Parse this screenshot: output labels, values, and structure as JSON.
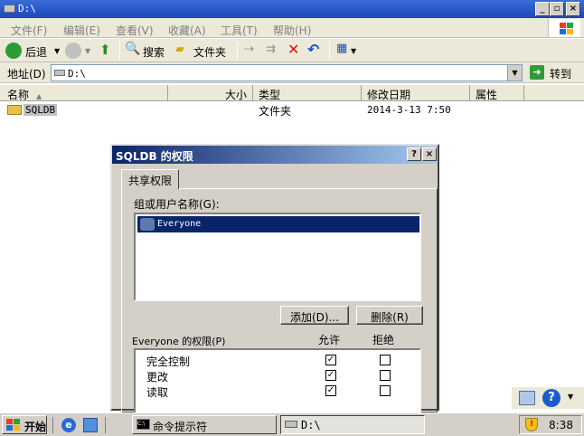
{
  "window": {
    "title": "D:\\"
  },
  "menu": [
    "文件(F)",
    "编辑(E)",
    "查看(V)",
    "收藏(A)",
    "工具(T)",
    "帮助(H)"
  ],
  "toolbar": {
    "back_label": "后退",
    "search_label": "搜索",
    "folders_label": "文件夹"
  },
  "address": {
    "label": "地址(D)",
    "value": "D:\\",
    "go_label": "转到"
  },
  "columns": [
    "名称",
    "大小",
    "类型",
    "修改日期",
    "属性"
  ],
  "files": [
    {
      "name": "SQLDB",
      "size": "",
      "type": "文件夹",
      "modified": "2014-3-13 7:50",
      "attr": ""
    }
  ],
  "dialog": {
    "title": "SQLDB 的权限",
    "help_label": "?",
    "close_label": "×",
    "tab_label": "共享权限",
    "group_label": "组或用户名称(G):",
    "users": [
      "Everyone"
    ],
    "add_label": "添加(D)...",
    "remove_label": "删除(R)",
    "perm_header": "Everyone 的权限(P)",
    "allow_label": "允许",
    "deny_label": "拒绝",
    "permissions": [
      {
        "name": "完全控制",
        "allow": true,
        "deny": false
      },
      {
        "name": "更改",
        "allow": true,
        "deny": false
      },
      {
        "name": "读取",
        "allow": true,
        "deny": false
      }
    ]
  },
  "taskbar": {
    "start_label": "开始",
    "tasks": [
      "命令提示符",
      "D:\\"
    ],
    "clock": "8:38"
  }
}
